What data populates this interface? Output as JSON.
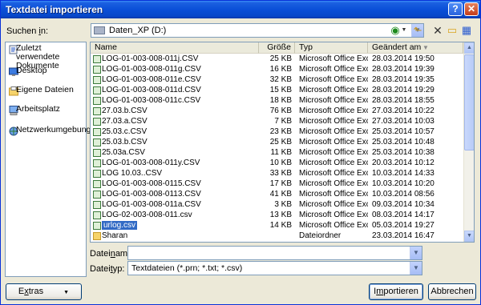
{
  "window": {
    "title": "Textdatei importieren",
    "help_label": "?",
    "close_label": "✕"
  },
  "lookin": {
    "label_pre": "Suchen ",
    "label_key": "i",
    "label_post": "n:",
    "value": "Daten_XP (D:)"
  },
  "toolbar": {
    "back_icon": "back-arrow-icon",
    "up_icon": "folder-up-icon",
    "delete_icon": "delete-icon",
    "new_folder_icon": "new-folder-icon",
    "views_icon": "views-menu-icon"
  },
  "places": [
    {
      "label": "Zuletzt verwendete Dokumente",
      "icon": "recent-documents-icon"
    },
    {
      "label": "Desktop",
      "icon": "desktop-icon"
    },
    {
      "label": "Eigene Dateien",
      "icon": "my-documents-icon"
    },
    {
      "label": "Arbeitsplatz",
      "icon": "my-computer-icon"
    },
    {
      "label": "Netzwerkumgebung",
      "icon": "network-icon"
    }
  ],
  "columns": {
    "name": "Name",
    "size": "Größe",
    "type": "Typ",
    "date": "Geändert am"
  },
  "files": [
    {
      "name": "LOG-01-003-008-011j.CSV",
      "size": "25 KB",
      "type": "Microsoft Office Exc...",
      "date": "28.03.2014 19:50"
    },
    {
      "name": "LOG-01-003-008-011g.CSV",
      "size": "16 KB",
      "type": "Microsoft Office Exc...",
      "date": "28.03.2014 19:39"
    },
    {
      "name": "LOG-01-003-008-011e.CSV",
      "size": "32 KB",
      "type": "Microsoft Office Exc...",
      "date": "28.03.2014 19:35"
    },
    {
      "name": "LOG-01-003-008-011d.CSV",
      "size": "15 KB",
      "type": "Microsoft Office Exc...",
      "date": "28.03.2014 19:29"
    },
    {
      "name": "LOG-01-003-008-011c.CSV",
      "size": "18 KB",
      "type": "Microsoft Office Exc...",
      "date": "28.03.2014 18:55"
    },
    {
      "name": "27.03.b.CSV",
      "size": "76 KB",
      "type": "Microsoft Office Exc...",
      "date": "27.03.2014 10:22"
    },
    {
      "name": "27.03.a.CSV",
      "size": "7 KB",
      "type": "Microsoft Office Exc...",
      "date": "27.03.2014 10:03"
    },
    {
      "name": "25.03.c.CSV",
      "size": "23 KB",
      "type": "Microsoft Office Exc...",
      "date": "25.03.2014 10:57"
    },
    {
      "name": "25.03.b.CSV",
      "size": "25 KB",
      "type": "Microsoft Office Exc...",
      "date": "25.03.2014 10:48"
    },
    {
      "name": "25.03a.CSV",
      "size": "11 KB",
      "type": "Microsoft Office Exc...",
      "date": "25.03.2014 10:38"
    },
    {
      "name": "LOG-01-003-008-011y.CSV",
      "size": "10 KB",
      "type": "Microsoft Office Exc...",
      "date": "20.03.2014 10:12"
    },
    {
      "name": "LOG 10.03..CSV",
      "size": "33 KB",
      "type": "Microsoft Office Exc...",
      "date": "10.03.2014 14:33"
    },
    {
      "name": "LOG-01-003-008-0115.CSV",
      "size": "17 KB",
      "type": "Microsoft Office Exc...",
      "date": "10.03.2014 10:20"
    },
    {
      "name": "LOG-01-003-008-0113.CSV",
      "size": "41 KB",
      "type": "Microsoft Office Exc...",
      "date": "10.03.2014 08:56"
    },
    {
      "name": "LOG-01-003-008-011a.CSV",
      "size": "3 KB",
      "type": "Microsoft Office Exc...",
      "date": "09.03.2014 10:34"
    },
    {
      "name": "LOG-02-003-008-011.csv",
      "size": "13 KB",
      "type": "Microsoft Office Exc...",
      "date": "08.03.2014 14:17"
    },
    {
      "name": "urlog.csv",
      "size": "14 KB",
      "type": "Microsoft Office Exc...",
      "date": "05.03.2014 19:27",
      "selected": true
    },
    {
      "name": "Sharan",
      "size": "",
      "type": "Dateiordner",
      "date": "23.03.2014 16:47",
      "folder": true
    }
  ],
  "filename": {
    "label_pre": "Datei",
    "label_key": "n",
    "label_post": "ame:",
    "value": ""
  },
  "filetype": {
    "label_pre": "Datei",
    "label_key": "t",
    "label_post": "yp:",
    "value": "Textdateien (*.prn; *.txt; *.csv)"
  },
  "buttons": {
    "extras_pre": "E",
    "extras_key": "x",
    "extras_post": "tras",
    "import_pre": "I",
    "import_key": "m",
    "import_post": "portieren",
    "cancel": "Abbrechen"
  },
  "colors": {
    "titlebar": "#0a4fd8",
    "dialog_bg": "#ece9d8",
    "selection": "#316ac5",
    "border": "#7f9db9"
  }
}
